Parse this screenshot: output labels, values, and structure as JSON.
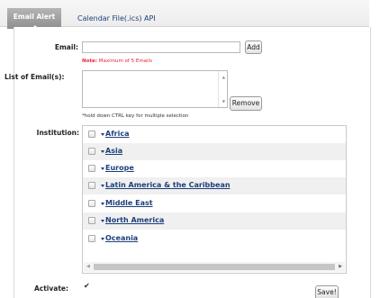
{
  "tabs": {
    "active": "Email Alert",
    "inactive": "Calendar File(.ics) API"
  },
  "email": {
    "label": "Email:",
    "value": "",
    "add_button": "Add",
    "note_prefix": "Note:",
    "note_text": " Maximum of 5 Emails"
  },
  "email_list": {
    "label": "List of Email(s):",
    "items": [],
    "remove_button": "Remove",
    "hint": "*hold down CTRL key for multiple selection"
  },
  "institution": {
    "label": "Institution:",
    "regions": [
      {
        "name": "Africa",
        "checked": false
      },
      {
        "name": "Asia",
        "checked": false
      },
      {
        "name": "Europe",
        "checked": false
      },
      {
        "name": "Latin America & the Caribbean",
        "checked": false
      },
      {
        "name": "Middle East",
        "checked": false
      },
      {
        "name": "North America",
        "checked": false
      },
      {
        "name": "Oceania",
        "checked": false
      }
    ]
  },
  "activate": {
    "label": "Activate:",
    "checked": true,
    "check_glyph": "✔"
  },
  "save_button": "Save!"
}
